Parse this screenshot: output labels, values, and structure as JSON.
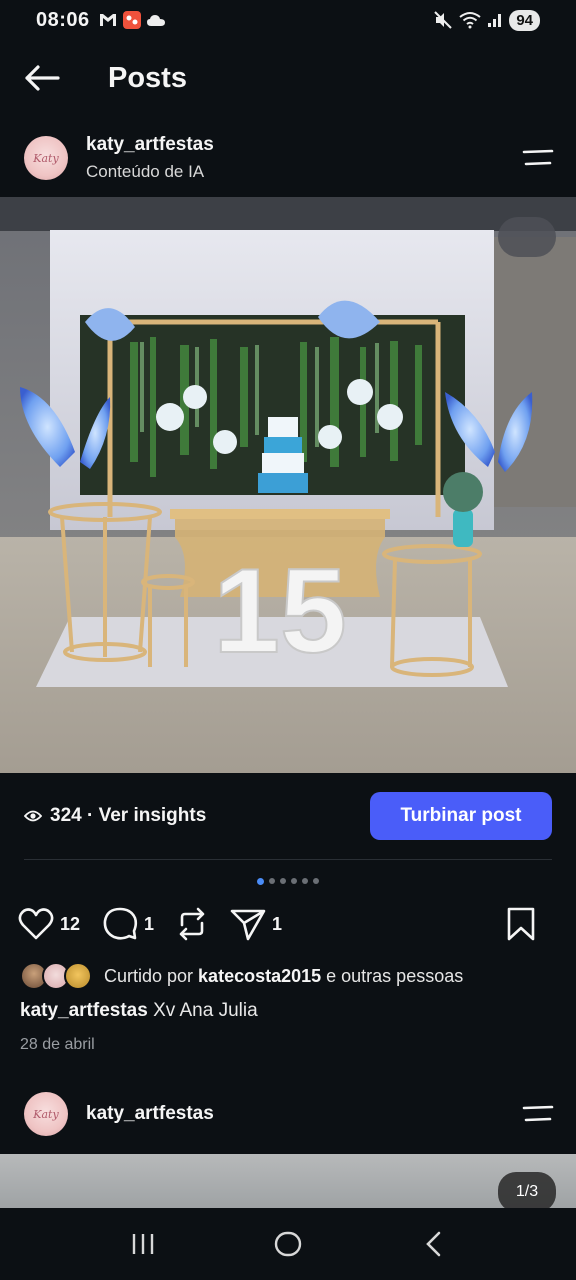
{
  "status_bar": {
    "time": "08:06",
    "left_icons": [
      "gmail-icon",
      "app-notification-icon",
      "cloud-icon"
    ],
    "right_icons": [
      "mute-icon",
      "wifi-icon",
      "signal-icon"
    ],
    "battery": "94"
  },
  "header": {
    "title": "Posts",
    "back_icon": "arrow-left-icon"
  },
  "post": {
    "username": "katy_artfestas",
    "subtitle": "Conteúdo de IA",
    "avatar_text": "Katy",
    "views": "324",
    "insights_label": "· Ver insights",
    "boost_label": "Turbinar post",
    "carousel_count": 6,
    "carousel_active": 0,
    "likes": "12",
    "comments": "1",
    "shares": "1",
    "liked_by_prefix": "Curtido por ",
    "liked_by_user": "katecosta2015",
    "liked_by_suffix": " e outras pessoas",
    "caption_user": "katy_artfestas",
    "caption_text": " Xv Ana Julia",
    "date": "28 de abril",
    "image_number": "15"
  },
  "next_post": {
    "username": "katy_artfestas",
    "avatar_text": "Katy",
    "page_indicator": "1/3"
  },
  "colors": {
    "accent": "#4a5df9",
    "background": "#0c1014",
    "active_dot": "#4a8cf7"
  }
}
